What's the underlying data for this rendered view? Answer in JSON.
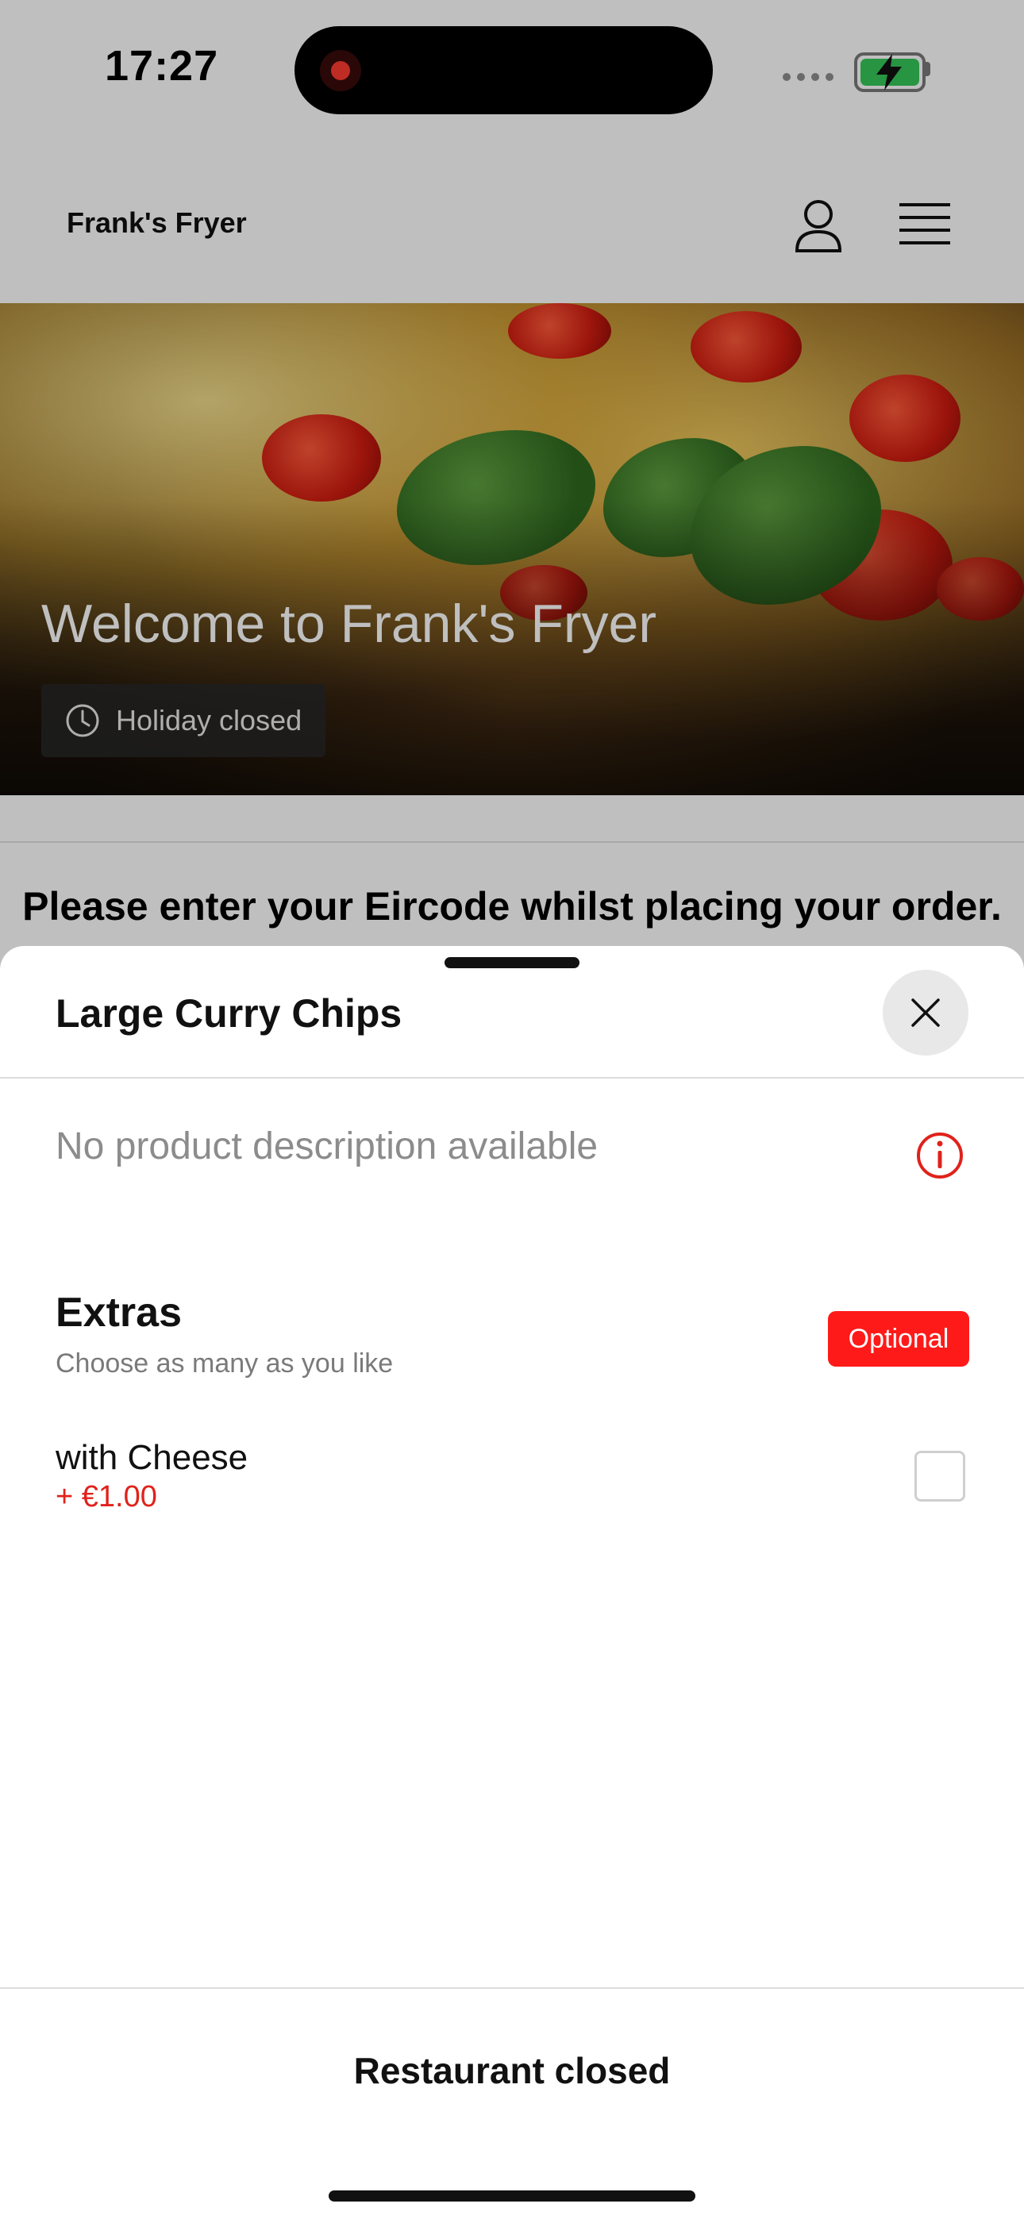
{
  "status_bar": {
    "time": "17:27"
  },
  "header": {
    "brand": "Frank's Fryer"
  },
  "hero": {
    "title": "Welcome to Frank's Fryer",
    "badge": "Holiday closed"
  },
  "notice": {
    "text": "Please enter your Eircode whilst placing your order."
  },
  "sheet": {
    "title": "Large Curry Chips",
    "description": "No product description available",
    "group": {
      "title": "Extras",
      "subtitle": "Choose as many as you like",
      "badge": "Optional",
      "options": [
        {
          "name": "with Cheese",
          "price": "+ €1.00",
          "checked": false
        }
      ]
    },
    "footer_button": "Restaurant closed"
  },
  "colors": {
    "accent_red": "#ff1a1a",
    "price_red": "#e0221b",
    "battery_green": "#34c759"
  },
  "icons": [
    "record-icon",
    "battery-icon",
    "user-icon",
    "menu-icon",
    "clock-icon",
    "close-icon",
    "info-icon"
  ]
}
